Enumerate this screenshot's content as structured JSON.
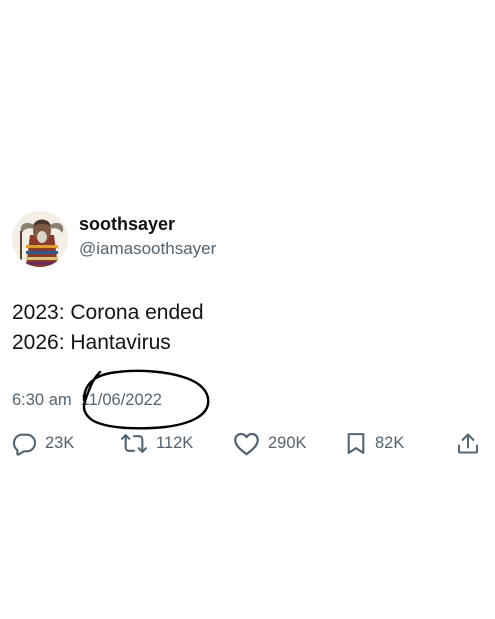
{
  "tweet": {
    "author": {
      "display_name": "soothsayer",
      "handle": "@iamasoothsayer"
    },
    "text_lines": [
      "2023: Corona ended",
      "2026: Hantavirus"
    ],
    "time": "6:30 am",
    "date": "11/06/2022",
    "actions": {
      "reply": {
        "icon": "reply-icon",
        "count": "23K"
      },
      "retweet": {
        "icon": "retweet-icon",
        "count": "112K"
      },
      "like": {
        "icon": "heart-icon",
        "count": "290K"
      },
      "bookmark": {
        "icon": "bookmark-icon",
        "count": "82K"
      },
      "share": {
        "icon": "share-icon"
      }
    }
  },
  "colors": {
    "text_primary": "#0f1419",
    "text_secondary": "#536471",
    "scribble": "#000000"
  }
}
